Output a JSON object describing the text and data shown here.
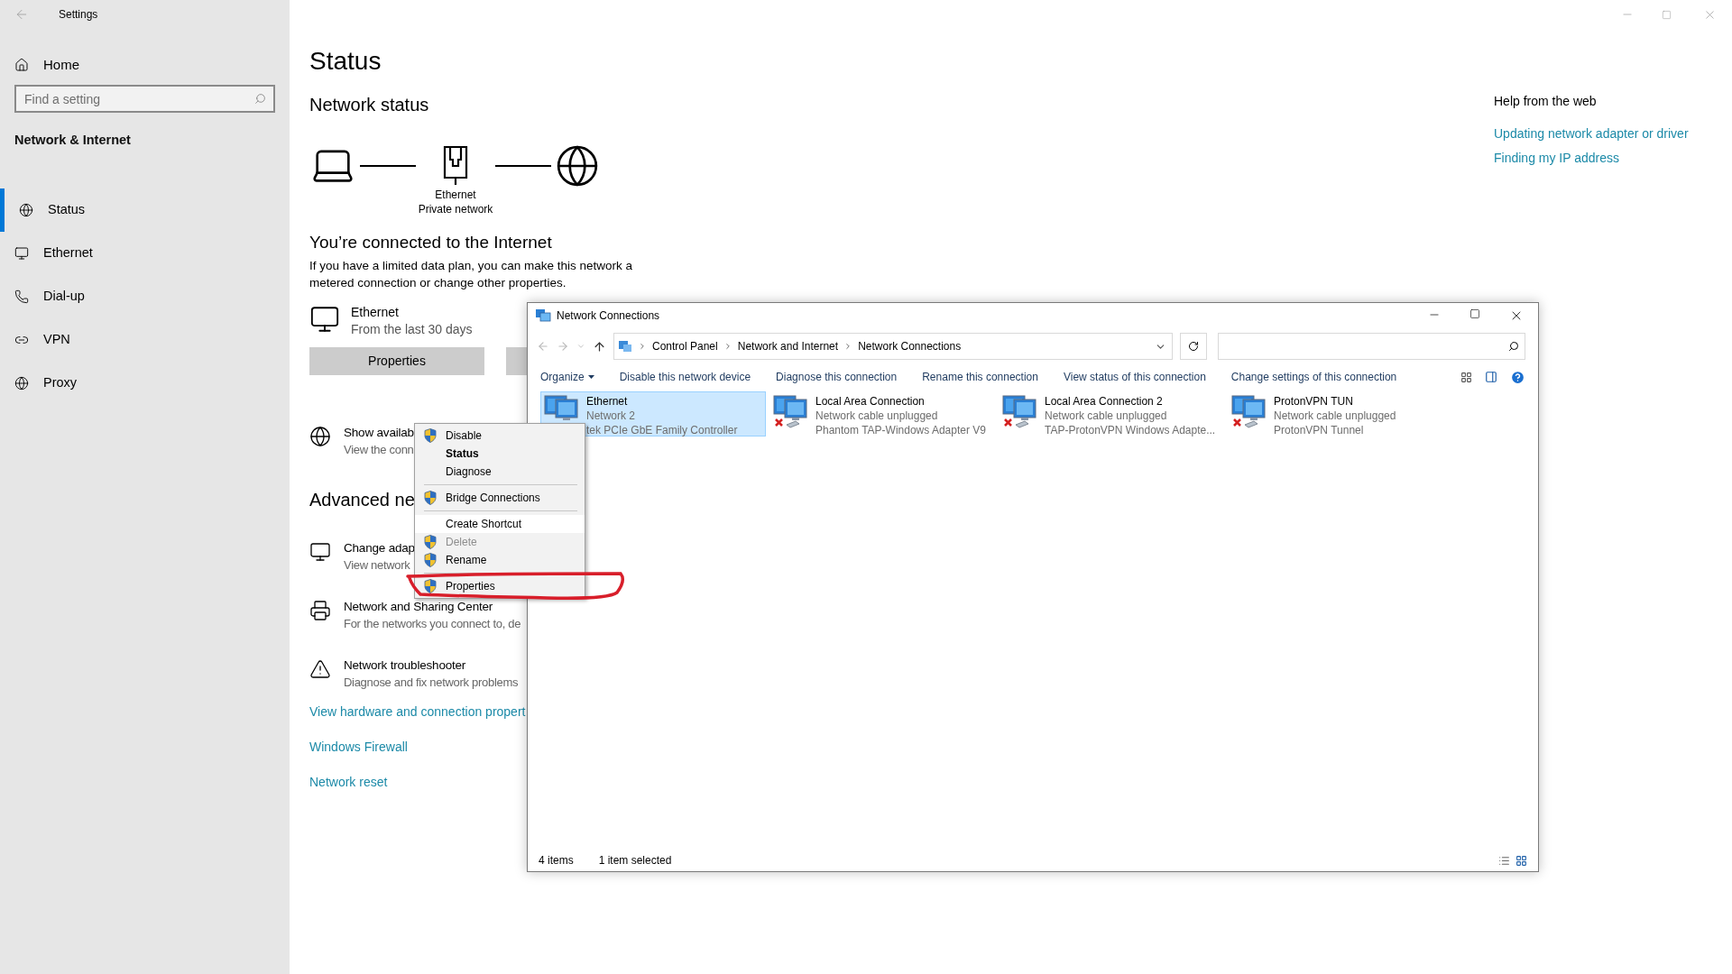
{
  "settings": {
    "title": "Settings",
    "home": "Home",
    "search": {
      "placeholder": "Find a setting"
    },
    "section": "Network & Internet",
    "nav": [
      {
        "label": "Status",
        "selected": true
      },
      {
        "label": "Ethernet",
        "selected": false
      },
      {
        "label": "Dial-up",
        "selected": false
      },
      {
        "label": "VPN",
        "selected": false
      },
      {
        "label": "Proxy",
        "selected": false
      }
    ]
  },
  "status_page": {
    "title": "Status",
    "network_status": "Network status",
    "diagram_labels": [
      "Ethernet",
      "Private network"
    ],
    "connected": "You’re connected to the Internet",
    "description": "If you have a limited data plan, you can make this network a metered connection or change other properties.",
    "connection": {
      "name": "Ethernet",
      "detail": "From the last 30 days"
    },
    "properties_button": "Properties",
    "options": [
      {
        "title": "Show availab",
        "subtitle": "View the conn"
      }
    ],
    "advanced_heading": "Advanced ne",
    "advanced": [
      {
        "title": "Change adap",
        "subtitle": "View network"
      },
      {
        "title": "Network and Sharing Center",
        "subtitle": "For the networks you connect to, de"
      },
      {
        "title": "Network troubleshooter",
        "subtitle": "Diagnose and fix network problems"
      }
    ],
    "links": [
      "View hardware and connection propert",
      "Windows Firewall",
      "Network reset"
    ]
  },
  "help": {
    "title": "Help from the web",
    "links": [
      "Updating network adapter or driver",
      "Finding my IP address"
    ]
  },
  "network_connections": {
    "title": "Network Connections",
    "breadcrumbs": [
      "Control Panel",
      "Network and Internet",
      "Network Connections"
    ],
    "toolbar": [
      {
        "label": "Organize",
        "kind": "menu"
      },
      {
        "label": "Disable this network device",
        "kind": "command"
      },
      {
        "label": "Diagnose this connection",
        "kind": "command"
      },
      {
        "label": "Rename this connection",
        "kind": "command"
      },
      {
        "label": "View status of this connection",
        "kind": "command"
      },
      {
        "label": "Change settings of this connection",
        "kind": "command"
      }
    ],
    "items": [
      {
        "name": "Ethernet",
        "status": "Network 2",
        "device": "tek PCIe GbE Family Controller",
        "selected": true,
        "disconnected": false
      },
      {
        "name": "Local Area Connection",
        "status": "Network cable unplugged",
        "device": "Phantom TAP-Windows Adapter V9",
        "selected": false,
        "disconnected": true
      },
      {
        "name": "Local Area Connection 2",
        "status": "Network cable unplugged",
        "device": "TAP-ProtonVPN Windows Adapte...",
        "selected": false,
        "disconnected": true
      },
      {
        "name": "ProtonVPN TUN",
        "status": "Network cable unplugged",
        "device": "ProtonVPN Tunnel",
        "selected": false,
        "disconnected": true
      }
    ],
    "status_bar": [
      "4 items",
      "1 item selected"
    ]
  },
  "context_menu": [
    {
      "kind": "item",
      "label": "Disable",
      "shield": true,
      "bold": false,
      "disabled": false,
      "highlighted": false
    },
    {
      "kind": "item",
      "label": "Status",
      "shield": false,
      "bold": true,
      "disabled": false,
      "highlighted": false
    },
    {
      "kind": "item",
      "label": "Diagnose",
      "shield": false,
      "bold": false,
      "disabled": false,
      "highlighted": false
    },
    {
      "kind": "separator"
    },
    {
      "kind": "item",
      "label": "Bridge Connections",
      "shield": true,
      "bold": false,
      "disabled": false,
      "highlighted": false
    },
    {
      "kind": "separator"
    },
    {
      "kind": "item",
      "label": "Create Shortcut",
      "shield": false,
      "bold": false,
      "disabled": false,
      "highlighted": true
    },
    {
      "kind": "item",
      "label": "Delete",
      "shield": true,
      "bold": false,
      "disabled": true,
      "highlighted": false
    },
    {
      "kind": "item",
      "label": "Rename",
      "shield": true,
      "bold": false,
      "disabled": false,
      "highlighted": false
    },
    {
      "kind": "separator"
    },
    {
      "kind": "item",
      "label": "Properties",
      "shield": true,
      "bold": false,
      "disabled": false,
      "highlighted": false
    }
  ]
}
